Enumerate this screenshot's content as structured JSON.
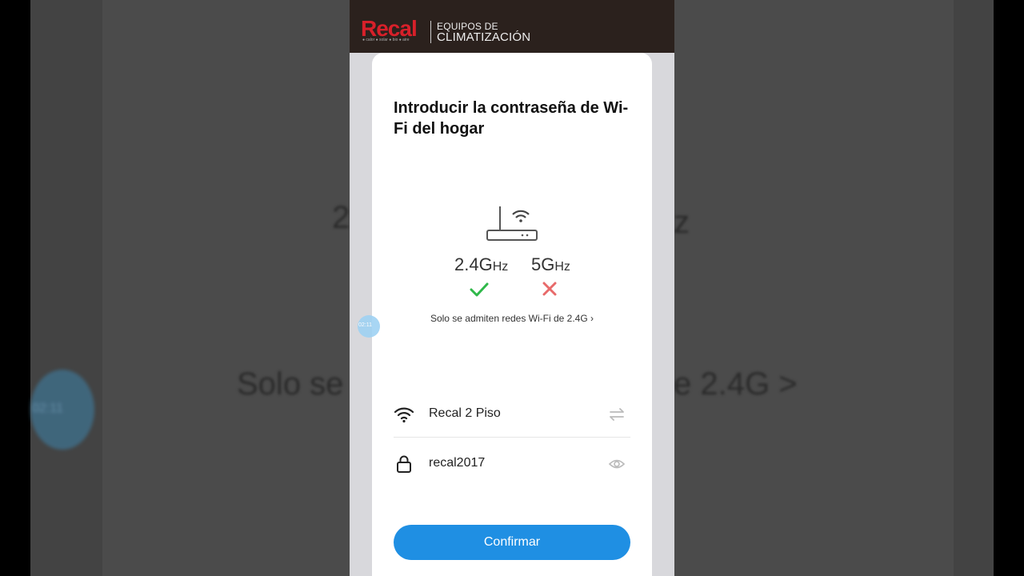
{
  "brand": {
    "name": "Recal",
    "tagline": "● calor ● solar ● bio ● aire",
    "line1": "EQUIPOS DE",
    "line2": "CLIMATIZACIÓN",
    "accent_color": "#d8202a"
  },
  "page": {
    "title": "Introducir la contraseña de Wi-Fi del hogar"
  },
  "bands": {
    "band_24_main": "2.4G",
    "band_24_unit": "Hz",
    "band_5_main": "5G",
    "band_5_unit": "Hz",
    "band_24_status_icon": "check-icon",
    "band_5_status_icon": "cross-icon"
  },
  "support_link": "Solo se admiten redes Wi-Fi de 2.4G",
  "fields": {
    "wifi_name": "Recal 2 Piso",
    "password": "recal2017"
  },
  "confirm_label": "Confirmar",
  "timer": "02:11",
  "background": {
    "big_text_left": "2.4",
    "big_text_right": "z",
    "big_text_mid_left": "Solo se",
    "big_text_mid_right": "e 2.4G >",
    "bubble_time": "02:11"
  },
  "colors": {
    "primary_button": "#1f8fe3",
    "check": "#2fb84a",
    "cross": "#e86a6a"
  }
}
